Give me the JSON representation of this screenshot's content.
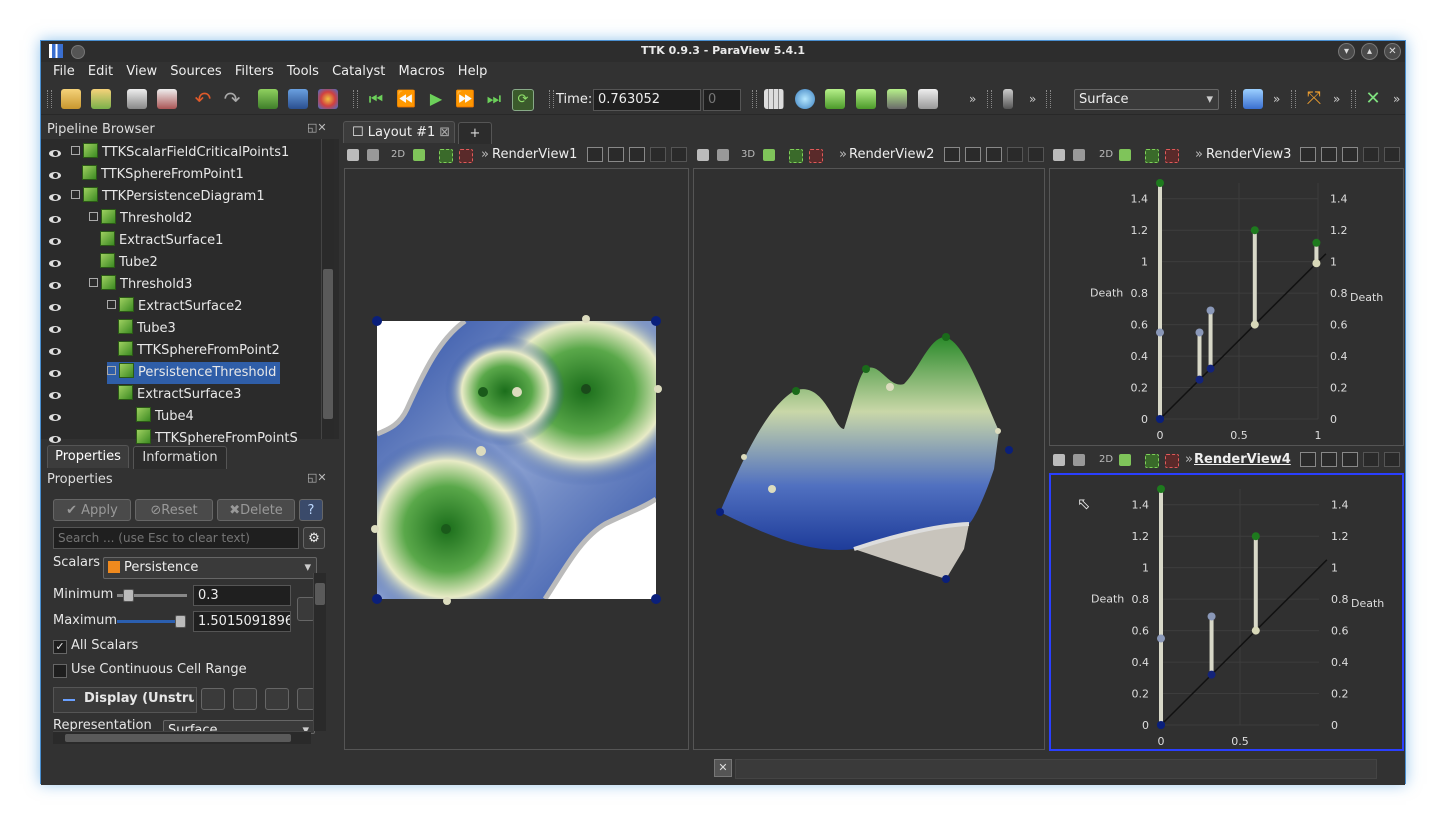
{
  "window": {
    "title": "TTK 0.9.3 - ParaView 5.4.1"
  },
  "menu": [
    "File",
    "Edit",
    "View",
    "Sources",
    "Filters",
    "Tools",
    "Catalyst",
    "Macros",
    "Help"
  ],
  "toolbar": {
    "time_label": "Time:",
    "time_value": "0.763052",
    "time_step": "0",
    "representation": "Surface"
  },
  "pipeline": {
    "title": "Pipeline Browser",
    "items": [
      {
        "label": "TTKScalarFieldCriticalPoints1",
        "indent": 0,
        "expander": true
      },
      {
        "label": "TTKSphereFromPoint1",
        "indent": 0,
        "expander": false
      },
      {
        "label": "TTKPersistenceDiagram1",
        "indent": 0,
        "expander": true
      },
      {
        "label": "Threshold2",
        "indent": 1,
        "expander": true
      },
      {
        "label": "ExtractSurface1",
        "indent": 1,
        "expander": false
      },
      {
        "label": "Tube2",
        "indent": 1,
        "expander": false
      },
      {
        "label": "Threshold3",
        "indent": 1,
        "expander": true
      },
      {
        "label": "ExtractSurface2",
        "indent": 2,
        "expander": true
      },
      {
        "label": "Tube3",
        "indent": 2,
        "expander": false
      },
      {
        "label": "TTKSphereFromPoint2",
        "indent": 2,
        "expander": false
      },
      {
        "label": "PersistenceThreshold",
        "indent": 2,
        "expander": true,
        "selected": true
      },
      {
        "label": "ExtractSurface3",
        "indent": 2,
        "expander": false
      },
      {
        "label": "Tube4",
        "indent": 3,
        "expander": false
      },
      {
        "label": "TTKSphereFromPointS",
        "indent": 3,
        "expander": false
      }
    ]
  },
  "props_tabs": {
    "properties": "Properties",
    "information": "Information"
  },
  "properties": {
    "title": "Properties",
    "apply": "Apply",
    "reset": "Reset",
    "delete": "Delete",
    "help": "?",
    "search_placeholder": "Search ... (use Esc to clear text)",
    "scalars_label": "Scalars",
    "scalars_value": "Persistence",
    "minimum_label": "Minimum",
    "minimum_value": "0.3",
    "maximum_label": "Maximum",
    "maximum_value": "1.50150918960",
    "all_scalars": "All Scalars",
    "use_continuous": "Use Continuous Cell Range",
    "display_header": "Display (Unstru",
    "representation_label": "Representation",
    "representation_value": "Surface"
  },
  "layout_tab": {
    "label": "Layout #1",
    "plus": "+"
  },
  "views": [
    {
      "name": "RenderView1",
      "mode": "2D"
    },
    {
      "name": "RenderView2",
      "mode": "3D"
    },
    {
      "name": "RenderView3",
      "mode": "2D"
    },
    {
      "name": "RenderView4",
      "mode": "2D"
    }
  ],
  "chart_data": [
    {
      "type": "scatter",
      "view": "RenderView3",
      "ylabel": "Death",
      "yticks": [
        "1.4",
        "1.2",
        "1",
        "0.8",
        "0.6",
        "0.4",
        "0.2",
        "0"
      ],
      "xticks": [
        "0",
        "0.5",
        "1"
      ],
      "xlim": [
        0,
        1
      ],
      "ylim": [
        0,
        1.5
      ],
      "pairs": [
        {
          "birth": 0.0,
          "death": 1.5
        },
        {
          "birth": 0.0,
          "death": 0.55
        },
        {
          "birth": 0.25,
          "death": 0.55
        },
        {
          "birth": 0.32,
          "death": 0.69
        },
        {
          "birth": 0.6,
          "death": 1.2
        },
        {
          "birth": 0.99,
          "death": 1.12
        }
      ]
    },
    {
      "type": "scatter",
      "view": "RenderView4",
      "ylabel": "Death",
      "yticks": [
        "1.4",
        "1.2",
        "1",
        "0.8",
        "0.6",
        "0.4",
        "0.2",
        "0"
      ],
      "xticks": [
        "0",
        "0.5"
      ],
      "xlim": [
        0,
        1
      ],
      "ylim": [
        0,
        1.5
      ],
      "pairs": [
        {
          "birth": 0.0,
          "death": 1.5
        },
        {
          "birth": 0.0,
          "death": 0.55
        },
        {
          "birth": 0.32,
          "death": 0.69
        },
        {
          "birth": 0.6,
          "death": 1.2
        }
      ]
    }
  ]
}
